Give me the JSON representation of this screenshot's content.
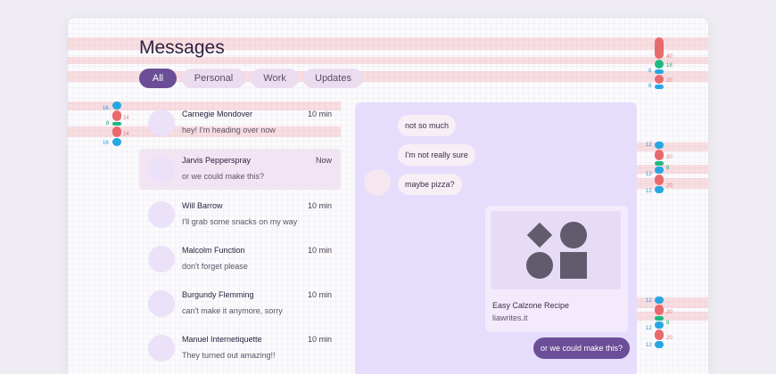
{
  "header": {
    "title": "Messages"
  },
  "filters": [
    {
      "label": "All",
      "active": true
    },
    {
      "label": "Personal",
      "active": false
    },
    {
      "label": "Work",
      "active": false
    },
    {
      "label": "Updates",
      "active": false
    }
  ],
  "conversations": [
    {
      "name": "Carnegie Mondover",
      "time": "10 min",
      "preview": "hey! I'm heading over now"
    },
    {
      "name": "Jarvis Pepperspray",
      "time": "Now",
      "preview": "or we could make this?"
    },
    {
      "name": "Will Barrow",
      "time": "10 min",
      "preview": "I'll grab some snacks on my way"
    },
    {
      "name": "Malcolm Function",
      "time": "10 min",
      "preview": "don't forget please"
    },
    {
      "name": "Burgundy Flemming",
      "time": "10 min",
      "preview": "can't make it anymore, sorry"
    },
    {
      "name": "Manuel Internetiquette",
      "time": "10 min",
      "preview": "They turned out amazing!!"
    }
  ],
  "chat": {
    "messages": [
      {
        "text": "not so much",
        "direction": "incoming"
      },
      {
        "text": "I'm not really sure",
        "direction": "incoming"
      },
      {
        "text": "maybe pizza?",
        "direction": "incoming"
      },
      {
        "text": "or we could make this?",
        "direction": "outgoing"
      }
    ],
    "card": {
      "title": "Easy Calzone Recipe",
      "source": "liawrites.it"
    }
  },
  "spec_labels": {
    "header": [
      "40",
      "16",
      "8",
      "20",
      "8"
    ],
    "list": [
      "16",
      "24",
      "8",
      "24",
      "16"
    ],
    "chat_top": [
      "12",
      "20",
      "8",
      "12",
      "20",
      "12"
    ],
    "chat_bottom": [
      "12",
      "20",
      "8",
      "12",
      "20",
      "12"
    ]
  },
  "colors": {
    "primary": "#6b4e97",
    "chip": "#ecdcef",
    "chat_panel": "#e6dcfb",
    "spacing_red": "#e86a6c",
    "spacing_cyan": "#27a7e2",
    "spacing_green": "#1fba83"
  }
}
